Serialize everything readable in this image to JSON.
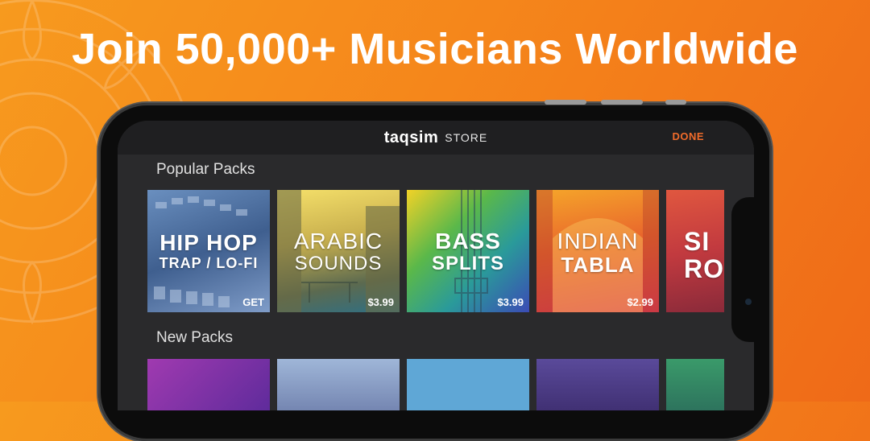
{
  "headline": "Join 50,000+ Musicians Worldwide",
  "store": {
    "brand": "taqsim",
    "brand_sub": "STORE",
    "done_label": "DONE"
  },
  "sections": {
    "popular_title": "Popular Packs",
    "new_title": "New Packs"
  },
  "popular_packs": [
    {
      "line1": "HIP HOP",
      "line2": "TRAP / LO-FI",
      "price": "GET"
    },
    {
      "line1": "ARABIC",
      "line2": "SOUNDS",
      "price": "$3.99"
    },
    {
      "line1": "BASS",
      "line2": "SPLITS",
      "price": "$3.99"
    },
    {
      "line1": "INDIAN",
      "line2": "TABLA",
      "price": "$2.99"
    },
    {
      "line1": "SI",
      "line2": "RO",
      "price": ""
    }
  ],
  "colors": {
    "accent": "#f06b2a",
    "background_start": "#f79a1e",
    "background_end": "#ef6a18"
  }
}
